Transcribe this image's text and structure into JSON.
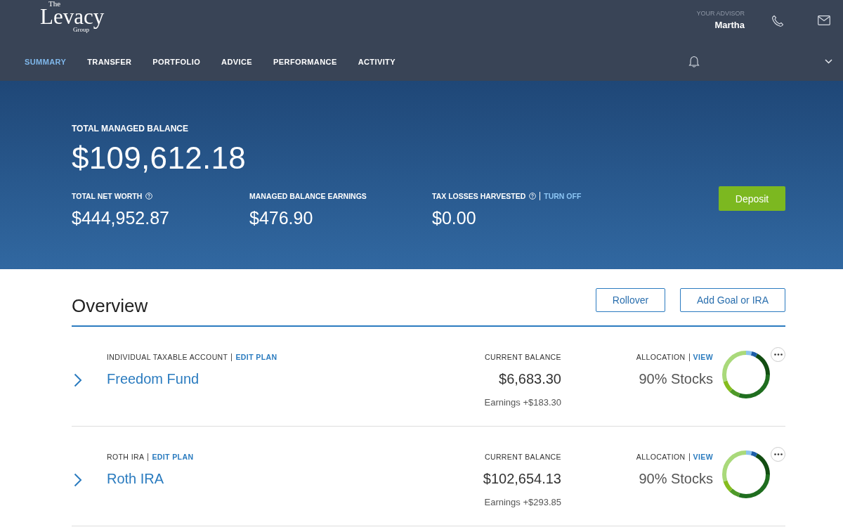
{
  "header": {
    "logo": {
      "top": "The",
      "main": "Levacy",
      "bottom": "Group"
    },
    "advisor_label": "YOUR ADVISOR",
    "advisor_name": "Martha"
  },
  "nav": [
    {
      "label": "SUMMARY",
      "selected": true
    },
    {
      "label": "TRANSFER",
      "selected": false
    },
    {
      "label": "PORTFOLIO",
      "selected": false
    },
    {
      "label": "ADVICE",
      "selected": false
    },
    {
      "label": "PERFORMANCE",
      "selected": false
    },
    {
      "label": "ACTIVITY",
      "selected": false
    }
  ],
  "summary": {
    "label": "TOTAL MANAGED BALANCE",
    "value": "$109,612.18",
    "stats": [
      {
        "label": "TOTAL NET WORTH",
        "help": true,
        "value": "$444,952.87"
      },
      {
        "label": "MANAGED BALANCE EARNINGS",
        "help": false,
        "value": "$476.90"
      },
      {
        "label": "TAX LOSSES HARVESTED",
        "help": true,
        "link": "TURN OFF",
        "value": "$0.00"
      }
    ],
    "deposit_button": "Deposit"
  },
  "overview": {
    "title": "Overview",
    "buttons": [
      "Rollover",
      "Add Goal or IRA"
    ],
    "accounts": [
      {
        "type": "INDIVIDUAL TAXABLE ACCOUNT",
        "edit_link": "EDIT PLAN",
        "name": "Freedom Fund",
        "balance_label": "CURRENT BALANCE",
        "balance": "$6,683.30",
        "earnings": "Earnings +$183.30",
        "allocation_label": "ALLOCATION",
        "allocation_link": "VIEW",
        "allocation": "90% Stocks"
      },
      {
        "type": "ROTH IRA",
        "edit_link": "EDIT PLAN",
        "name": "Roth IRA",
        "balance_label": "CURRENT BALANCE",
        "balance": "$102,654.13",
        "earnings": "Earnings +$293.85",
        "allocation_label": "ALLOCATION",
        "allocation_link": "VIEW",
        "allocation": "90% Stocks"
      }
    ]
  }
}
